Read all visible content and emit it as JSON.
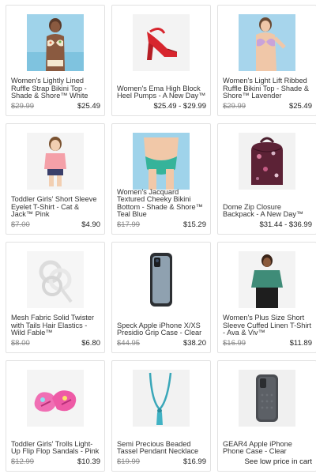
{
  "products": [
    {
      "title": "Women's Lightly Lined Ruffle Strap Bikini Top - Shade & Shore™ White",
      "reg_price": "$29.99",
      "price": "$25.49",
      "image": "bikini-top-white-floral-photo"
    },
    {
      "title": "Women's Ema High Block Heel Pumps - A New Day™",
      "reg_price": "",
      "price": "$25.49 - $29.99",
      "image": "red-heel-pump-photo"
    },
    {
      "title": "Women's Light Lift Ribbed Ruffle Bikini Top - Shade & Shore™ Lavender",
      "reg_price": "$29.99",
      "price": "$25.49",
      "image": "bikini-top-lavender-photo"
    },
    {
      "title": "Toddler Girls' Short Sleeve Eyelet T-Shirt - Cat & Jack™ Pink",
      "reg_price": "$7.00",
      "price": "$4.90",
      "image": "toddler-pink-tshirt-photo"
    },
    {
      "title": "Women's Jacquard Textured Cheeky Bikini Bottom - Shade & Shore™ Teal Blue",
      "reg_price": "$17.99",
      "price": "$15.29",
      "image": "teal-bikini-bottom-photo"
    },
    {
      "title": "Dome Zip Closure Backpack - A New Day™",
      "reg_price": "",
      "price": "$31.44 - $36.99",
      "image": "floral-backpack-photo"
    },
    {
      "title": "Mesh Fabric Solid Twister with Tails Hair Elastics - Wild Fable™",
      "reg_price": "$8.00",
      "price": "$6.80",
      "image": "white-hair-elastics-photo"
    },
    {
      "title": "Speck Apple iPhone X/XS Presidio Grip Case - Clear",
      "reg_price": "$44.95",
      "price": "$38.20",
      "image": "clear-iphone-case-photo"
    },
    {
      "title": "Women's Plus Size Short Sleeve Cuffed Linen T-Shirt - Ava & Viv™",
      "reg_price": "$16.99",
      "price": "$11.89",
      "image": "green-linen-tshirt-photo"
    },
    {
      "title": "Toddler Girls' Trolls Light-Up Flip Flop Sandals - Pink",
      "reg_price": "$12.99",
      "price": "$10.39",
      "image": "pink-trolls-sandals-photo"
    },
    {
      "title": "Semi Precious Beaded Tassel Pendant Necklace",
      "reg_price": "$19.99",
      "price": "$16.99",
      "image": "teal-tassel-necklace-photo"
    },
    {
      "title": "GEAR4 Apple iPhone Phone Case - Clear",
      "reg_price": "",
      "price": "See low price in cart",
      "image": "gray-phone-case-photo"
    }
  ]
}
